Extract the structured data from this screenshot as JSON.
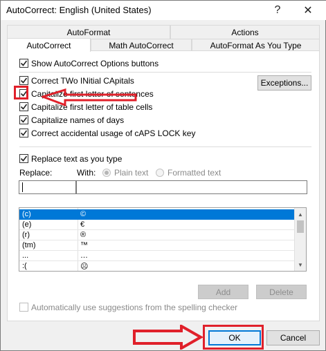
{
  "window": {
    "title": "AutoCorrect: English (United States)",
    "help": "?",
    "close": "✕"
  },
  "tabs": {
    "top_row": [
      "AutoFormat",
      "Actions"
    ],
    "bottom_row": [
      "AutoCorrect",
      "Math AutoCorrect",
      "AutoFormat As You Type"
    ],
    "active": "AutoCorrect"
  },
  "options": {
    "show_buttons": "Show AutoCorrect Options buttons",
    "correct_two": "Correct TWo INitial CApitals",
    "capitalize_first": "Capitalize first letter of sentences",
    "capitalize_table": "Capitalize first letter of table cells",
    "capitalize_days": "Capitalize names of days",
    "caps_lock": "Correct accidental usage of cAPS LOCK key"
  },
  "exceptions_button": "Exceptions...",
  "replace_section": {
    "checkbox_label": "Replace text as you type",
    "replace_label": "Replace:",
    "with_label": "With:",
    "plain_text": "Plain text",
    "formatted_text": "Formatted text",
    "replace_value": "",
    "with_value": ""
  },
  "entries": [
    {
      "replace": "(c)",
      "with": "©",
      "selected": true
    },
    {
      "replace": "(e)",
      "with": "€",
      "selected": false
    },
    {
      "replace": "(r)",
      "with": "®",
      "selected": false
    },
    {
      "replace": "(tm)",
      "with": "™",
      "selected": false
    },
    {
      "replace": "...",
      "with": "…",
      "selected": false
    },
    {
      "replace": ":(",
      "with": "☹",
      "selected": false
    }
  ],
  "buttons": {
    "add": "Add",
    "delete": "Delete",
    "ok": "OK",
    "cancel": "Cancel"
  },
  "suggestions_label": "Automatically use suggestions from the spelling checker",
  "colors": {
    "selection": "#0078d7",
    "annotation": "#e0202a"
  }
}
